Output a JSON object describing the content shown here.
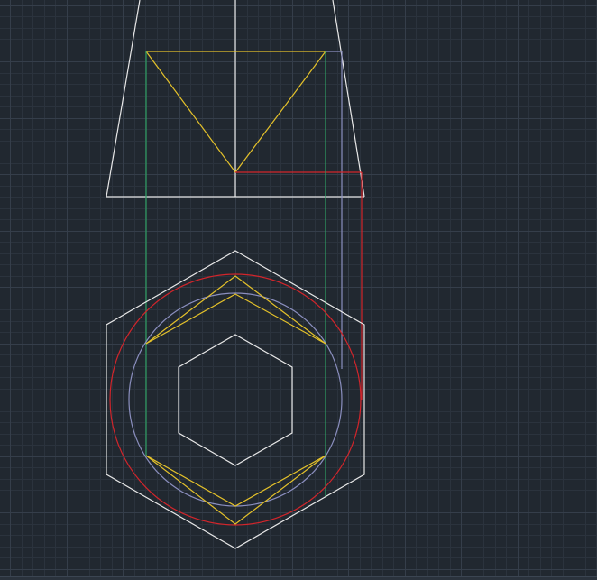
{
  "canvas": {
    "background": "#212830",
    "grid_minor": "#2b333d",
    "grid_major": "#353e4a"
  },
  "palette": {
    "white": "#e8e8e8",
    "yellow": "#e5c22a",
    "green": "#2f9f63",
    "red": "#d3252b",
    "lavender": "#8b8fbf"
  }
}
